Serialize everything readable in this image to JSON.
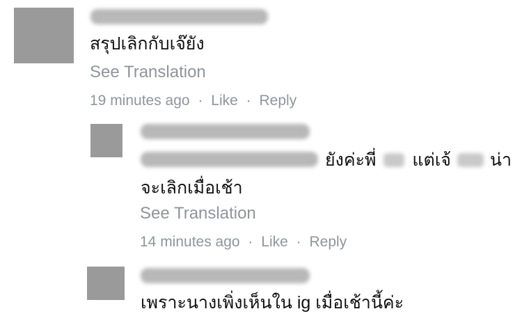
{
  "comments": [
    {
      "text": "สรุปเลิกกับเจ๊ยัง",
      "translate": "See Translation",
      "meta": {
        "time": "19 minutes ago",
        "like": "Like",
        "reply": "Reply",
        "sep": "·"
      }
    },
    {
      "text_seg1": "ยังค่ะพี่",
      "text_seg2": "แต่เจ้",
      "text_seg3": "น่า",
      "text_line2": "จะเลิกเมื่อเช้า",
      "translate": "See Translation",
      "meta": {
        "time": "14 minutes ago",
        "like": "Like",
        "reply": "Reply",
        "sep": "·"
      }
    },
    {
      "text": "เพราะนางเพิ่งเห็นใน ig เมื่อเช้านี้ค่ะ"
    }
  ]
}
